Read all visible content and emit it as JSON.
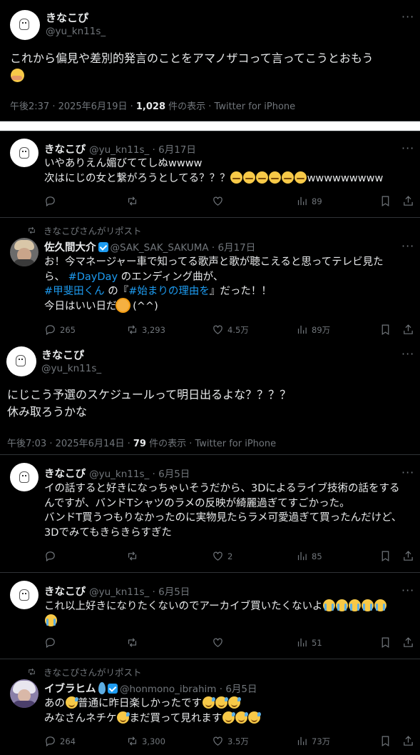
{
  "main_tweet": {
    "name": "きなこぴ",
    "handle": "@yu_kn11s_",
    "text": "これから偏見や差別的発言のことをアマノザコって言ってこうとおもう",
    "emoji": "hug-emoji",
    "meta_time": "午後2:37 · 2025年6月19日 · ",
    "meta_views": "1,028",
    "meta_tail": " 件の表示 · Twitter for iPhone"
  },
  "reply1": {
    "name": "きなこぴ",
    "handle": "@yu_kn11s_",
    "date": "6月17日",
    "line1": "いやありえん媚びててしぬwwww",
    "line2_prefix": "次はにじの女と繋がろうとしてる？？？",
    "line2_suffix": "wwwwwwwww",
    "views": "89"
  },
  "repost1": {
    "repost_label": "きなこぴさんがリポスト",
    "name": "佐久間大介",
    "handle": "@SAK_SAK_SAKUMA",
    "date": "6月17日",
    "line1": "お！今マネージャー車で知ってる歌声と歌が聴こえると思ってテレビ見た",
    "line2_prefix": "ら、 ",
    "hashtag1": "#DayDay",
    "line2_suffix": " のエンディング曲が、",
    "hashtag2": "#甲斐田くん",
    "line3_mid": " の『",
    "hashtag3": "#始まりの理由を",
    "line3_suffix": "』だった！！",
    "line4": "今日はいい日だ",
    "line4_suffix": " (^^)",
    "replies": "265",
    "reposts": "3,293",
    "likes": "4.5万",
    "views": "89万"
  },
  "tweet2": {
    "name": "きなこぴ",
    "handle": "@yu_kn11s_",
    "line1": "にじこう予選のスケジュールって明日出るよな？？？？",
    "line2": "休み取ろうかな",
    "meta_time": "午後7:03 · 2025年6月14日 · ",
    "meta_views": "79",
    "meta_tail": " 件の表示 · Twitter for iPhone"
  },
  "reply2": {
    "name": "きなこぴ",
    "handle": "@yu_kn11s_",
    "date": "6月5日",
    "line1": "イの話すると好きになっちゃいそうだから、3Dによるライブ技術の話をする",
    "line2": "んですが、バンドTシャツのラメの反映が綺麗過ぎてすごかった。",
    "line3": "バンドT買うつもりなかったのに実物見たらラメ可愛過ぎて買ったんだけど、",
    "line4": "3Dでみてもきらきらすぎた",
    "likes": "2",
    "views": "85"
  },
  "reply3": {
    "name": "きなこぴ",
    "handle": "@yu_kn11s_",
    "date": "6月5日",
    "line1": "これ以上好きになりたくないのでアーカイブ買いたくないよ",
    "views": "51"
  },
  "repost2": {
    "repost_label": "きなこぴさんがリポスト",
    "name": "イブラヒム",
    "handle": "@honmono_ibrahim",
    "date": "6月5日",
    "line1_prefix": "あの",
    "line1_suffix": "普通に昨日楽しかったです",
    "line2_prefix": "みなさんネチケ",
    "line2_suffix": "まだ買って見れます",
    "replies": "264",
    "reposts": "3,300",
    "likes": "3.5万",
    "views": "73万"
  },
  "sep": " · ",
  "more_label": "···",
  "colors": {
    "background": "#000000",
    "text": "#e7e9ea",
    "muted": "#71767b",
    "link": "#1d9bf0",
    "divider": "#2f3336"
  }
}
